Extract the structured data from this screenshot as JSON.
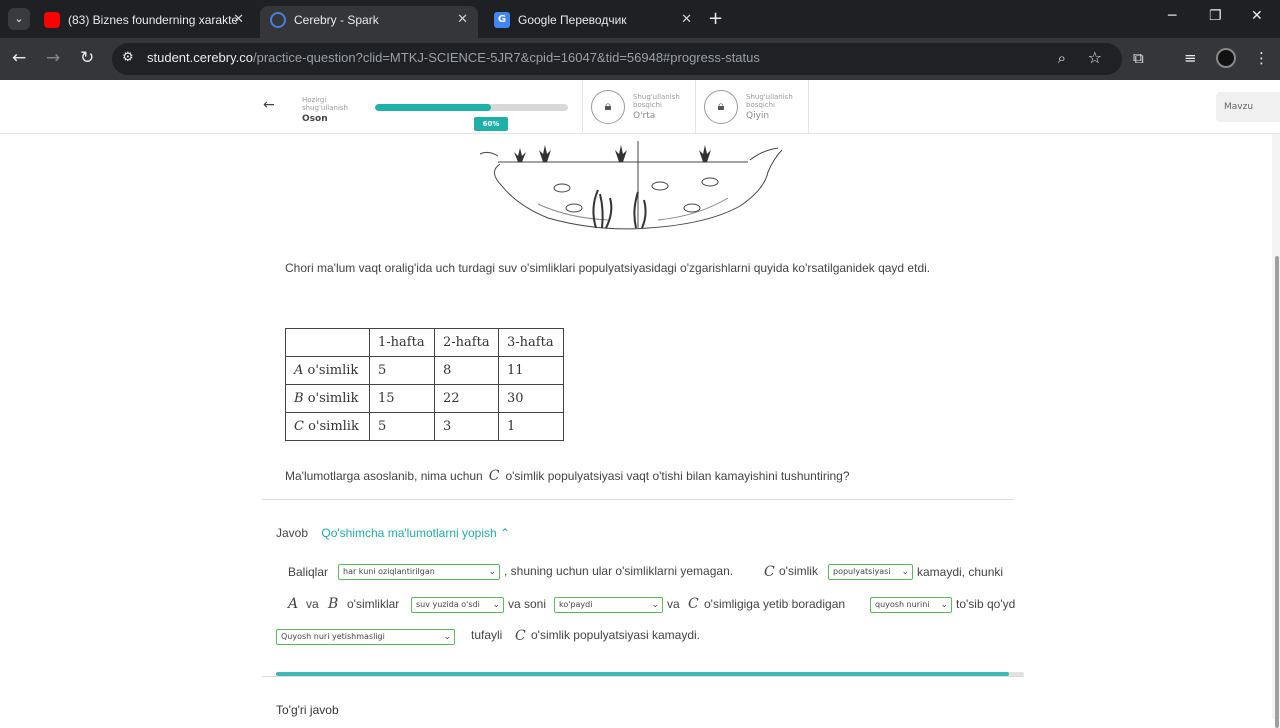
{
  "browser": {
    "tabs": [
      {
        "title": "(83) Biznes founderning xarakte",
        "favicon": "youtube-icon",
        "active": false
      },
      {
        "title": "Cerebry - Spark",
        "favicon": "cerebry-icon",
        "active": true
      },
      {
        "title": "Google Переводчик",
        "favicon": "google-translate-icon",
        "active": false
      }
    ],
    "url_host": "student.cerebry.co",
    "url_path": "/practice-question?clid=MTKJ-SCIENCE-5JR7&cpid=16047&tid=56948#progress-status"
  },
  "progress": {
    "current_label": "Hozirgi shug'ullanish",
    "current_level": "Oson",
    "percent_label": "60%",
    "percent": 60,
    "locked_levels": [
      {
        "label": "Shug'ullanish bosqichi",
        "name": "O'rta"
      },
      {
        "label": "Shug'ullanish bosqichi",
        "name": "Qiyin"
      }
    ],
    "topic_button": "Mavzu"
  },
  "question": {
    "intro": "Chori ma'lum vaqt oralig'ida uch turdagi suv o'simliklari populyatsiyasidagi o'zgarishlarni quyida ko'rsatilganidek qayd etdi.",
    "table": {
      "headers": [
        "",
        "1-hafta",
        "2-hafta",
        "3-hafta"
      ],
      "rows": [
        {
          "plant": "A",
          "suffix": "o'simlik",
          "values": [
            "5",
            "8",
            "11"
          ]
        },
        {
          "plant": "B",
          "suffix": "o'simlik",
          "values": [
            "15",
            "22",
            "30"
          ]
        },
        {
          "plant": "C",
          "suffix": "o'simlik",
          "values": [
            "5",
            "3",
            "1"
          ]
        }
      ]
    },
    "prompt_before": "Ma'lumotlarga asoslanib, nima uchun",
    "prompt_math": "C",
    "prompt_after": "o'simlik populyatsiyasi vaqt o'tishi bilan kamayishini tushuntiring?"
  },
  "answer": {
    "label": "Javob",
    "toggle": "Qo'shimcha ma'lumotlarni yopish",
    "line1": {
      "t1": "Baliqlar",
      "dd1": "har kuni oziqlantirilgan",
      "t2": ", shuning uchun ular o'simliklarni yemagan.",
      "m1": "C",
      "t3": "o'simlik",
      "dd2": "populyatsiyasi",
      "t4": "kamaydi, chunki"
    },
    "line2": {
      "m1": "A",
      "t1": "va",
      "m2": "B",
      "t2": "o'simliklar",
      "dd1": "suv yuzida o'sdi",
      "t3": "va soni",
      "dd2": "ko'paydi",
      "t4": "va",
      "m3": "C",
      "t5": "o'simligiga yetib boradigan",
      "dd3": "quyosh nurini",
      "t6": "to'sib qo'yd"
    },
    "line3": {
      "dd1": "Quyosh nuri yetishmasligi",
      "t1": "tufayli",
      "m1": "C",
      "t2": "o'simlik populyatsiyasi kamaydi."
    },
    "progress_fraction": 0.98,
    "correct_label": "To'g'ri javob"
  }
}
